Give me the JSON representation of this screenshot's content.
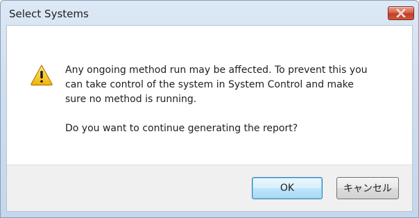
{
  "window": {
    "title": "Select Systems",
    "close_icon": "close-icon"
  },
  "message": {
    "icon": "warning-icon",
    "lines": [
      "Any ongoing method run may be affected. To prevent this you",
      "can take control of the system in System Control and make",
      "sure no method is running."
    ],
    "question": "Do you want to continue generating the report?"
  },
  "buttons": {
    "ok_label": "OK",
    "cancel_label": "キャンセル"
  },
  "colors": {
    "close_button": "#c8452b",
    "warning_fill": "#f5c518",
    "default_button_border": "#3c7fb1"
  }
}
